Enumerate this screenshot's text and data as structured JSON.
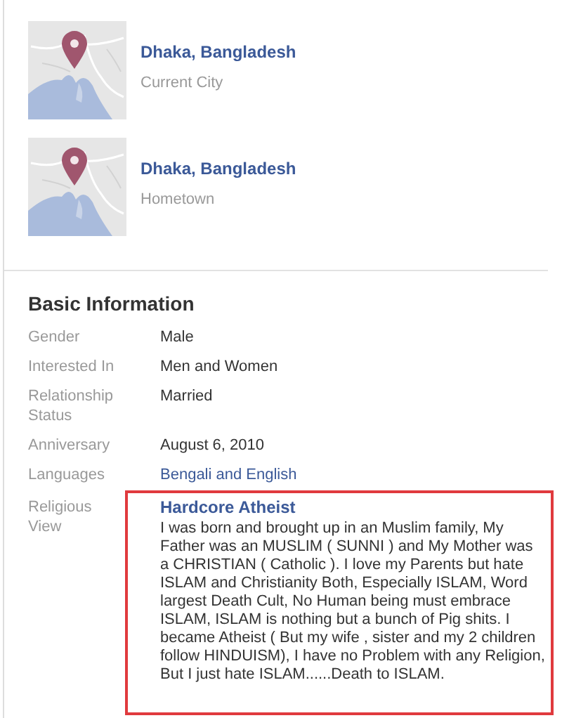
{
  "places": [
    {
      "name": "Dhaka, Bangladesh",
      "caption": "Current City"
    },
    {
      "name": "Dhaka, Bangladesh",
      "caption": "Hometown"
    }
  ],
  "basic_information": {
    "title": "Basic Information",
    "rows": [
      {
        "kind": "text",
        "label": "Gender",
        "value": "Male"
      },
      {
        "kind": "text",
        "label": "Interested In",
        "value": "Men and Women"
      },
      {
        "kind": "text",
        "label": "Relationship Status",
        "value": "Married"
      },
      {
        "kind": "text",
        "label": "Anniversary",
        "value": "August 6, 2010"
      },
      {
        "kind": "link",
        "label": "Languages",
        "value": "Bengali and English"
      },
      {
        "kind": "highlighted",
        "label": "Religious View",
        "value": "Hardcore Atheist",
        "description": "I was born and brought up in an Muslim family, My Father was an MUSLIM ( SUNNI ) and My Mother was a CHRISTIAN ( Catholic ). I love my Parents but hate ISLAM and Christianity Both, Especially ISLAM, Word largest Death Cult, No Human being must embrace ISLAM, ISLAM is nothing but a bunch of Pig shits. I became Atheist ( But my wife , sister and my 2 children follow HINDUISM), I have no Problem with any Religion, But I just hate ISLAM......Death to ISLAM."
      }
    ]
  }
}
